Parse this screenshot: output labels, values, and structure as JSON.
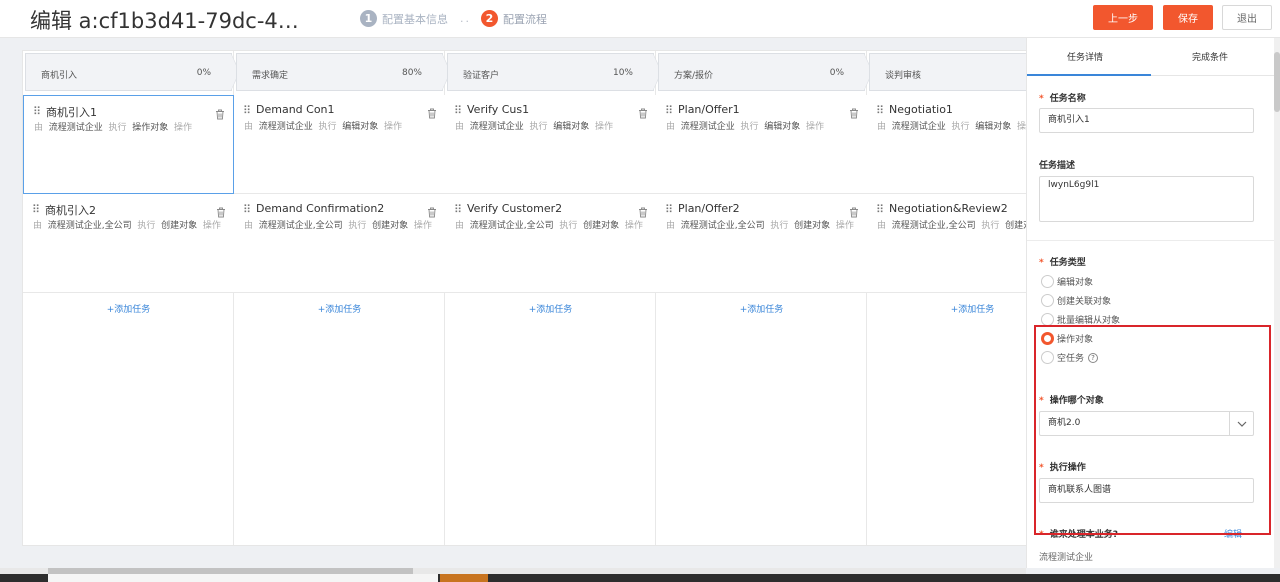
{
  "header": {
    "title": "编辑 a:cf1b3d41-79dc-4…",
    "steps": [
      {
        "num": "1",
        "label": "配置基本信息"
      },
      {
        "num": "2",
        "label": "配置流程"
      }
    ],
    "step_separator": "..",
    "buttons": {
      "prev": "上一步",
      "save": "保存",
      "exit": "退出"
    }
  },
  "stages": [
    {
      "name": "商机引入",
      "percent": "0%"
    },
    {
      "name": "需求确定",
      "percent": "80%"
    },
    {
      "name": "验证客户",
      "percent": "10%"
    },
    {
      "name": "方案/报价",
      "percent": "0%"
    },
    {
      "name": "谈判审核",
      "percent": ""
    }
  ],
  "tasks": [
    [
      {
        "name": "商机引入1",
        "by": "由",
        "owner": "流程测试企业",
        "exec": "执行",
        "action": "操作对象",
        "suffix": "操作"
      },
      {
        "name": "商机引入2",
        "by": "由",
        "owner": "流程测试企业,全公司",
        "exec": "执行",
        "action": "创建对象",
        "suffix": "操作"
      }
    ],
    [
      {
        "name": "Demand Con1",
        "by": "由",
        "owner": "流程测试企业",
        "exec": "执行",
        "action": "编辑对象",
        "suffix": "操作"
      },
      {
        "name": "Demand Confirmation2",
        "by": "由",
        "owner": "流程测试企业,全公司",
        "exec": "执行",
        "action": "创建对象",
        "suffix": "操作"
      }
    ],
    [
      {
        "name": "Verify Cus1",
        "by": "由",
        "owner": "流程测试企业",
        "exec": "执行",
        "action": "编辑对象",
        "suffix": "操作"
      },
      {
        "name": "Verify Customer2",
        "by": "由",
        "owner": "流程测试企业,全公司",
        "exec": "执行",
        "action": "创建对象",
        "suffix": "操作"
      }
    ],
    [
      {
        "name": "Plan/Offer1",
        "by": "由",
        "owner": "流程测试企业",
        "exec": "执行",
        "action": "编辑对象",
        "suffix": "操作"
      },
      {
        "name": "Plan/Offer2",
        "by": "由",
        "owner": "流程测试企业,全公司",
        "exec": "执行",
        "action": "创建对象",
        "suffix": "操作"
      }
    ],
    [
      {
        "name": "Negotiatio1",
        "by": "由",
        "owner": "流程测试企业",
        "exec": "执行",
        "action": "编辑对象",
        "suffix": "操"
      },
      {
        "name": "Negotiation&Review2",
        "by": "由",
        "owner": "流程测试企业,全公司",
        "exec": "执行",
        "action": "创建对象",
        "suffix": "操作"
      }
    ]
  ],
  "add_task_label": "+添加任务",
  "panel": {
    "tabs": [
      "任务详情",
      "完成条件"
    ],
    "task_name_label": "任务名称",
    "task_name_value": "商机引入1",
    "task_desc_label": "任务描述",
    "task_desc_value": "lwynL6g9l1",
    "task_type_label": "任务类型",
    "task_types": [
      "编辑对象",
      "创建关联对象",
      "批量编辑从对象",
      "操作对象",
      "空任务"
    ],
    "selected_type": "操作对象",
    "object_label": "操作哪个对象",
    "object_value": "商机2.0",
    "exec_label": "执行操作",
    "exec_value": "商机联系人图谱",
    "handler_label": "谁来处理本业务?",
    "handler_edit": "编辑",
    "handler_value": "流程测试企业"
  },
  "colors": {
    "accent": "#f2572e",
    "link": "#3a86d9",
    "highlight": "#d9252a"
  }
}
